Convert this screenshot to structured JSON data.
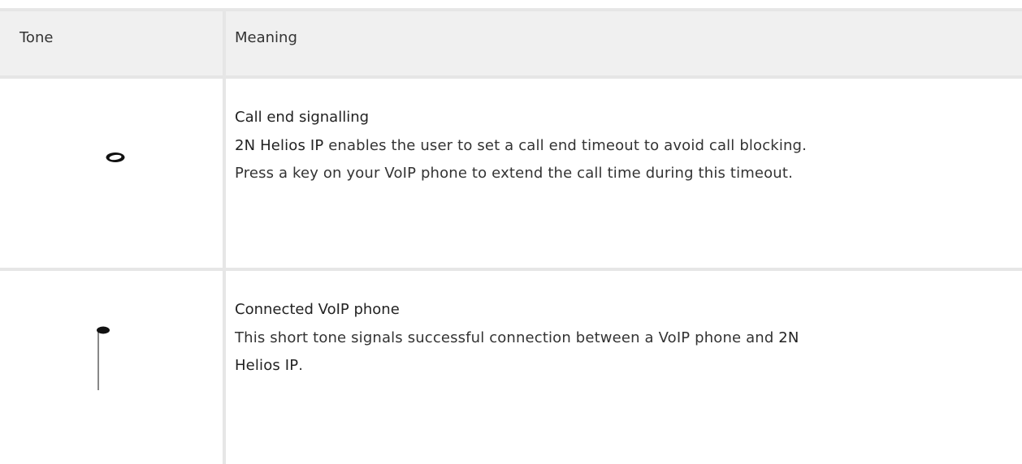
{
  "table": {
    "headers": {
      "tone": "Tone",
      "meaning": "Meaning"
    },
    "rows": [
      {
        "tone_icon": "whole-note-icon",
        "title": "Call end signalling",
        "text_bold_lead": "2N Helios IP",
        "text_line1_rest": " enables the user to set a call end timeout to avoid call blocking.",
        "text_line2": "Press a key on your VoIP phone to extend the call time during this timeout."
      },
      {
        "tone_icon": "quarter-note-icon",
        "title": "Connected VoIP phone",
        "text_line1": "This short tone signals successful connection between a VoIP phone and ",
        "text_bold_2n": "2N",
        "text_bold_helios": "Helios IP",
        "text_end": "."
      }
    ]
  }
}
